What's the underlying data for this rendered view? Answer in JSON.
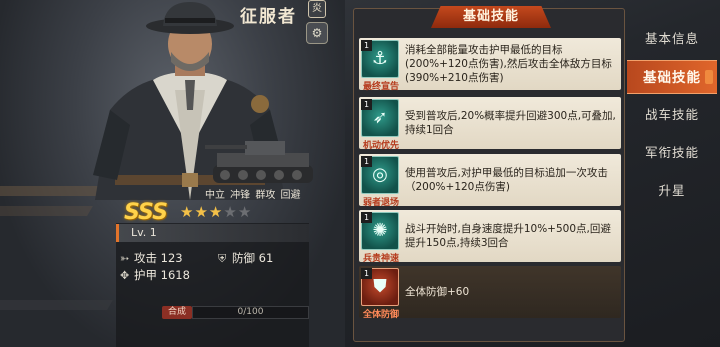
{
  "hero": {
    "title": "征服者",
    "rank_badge": "炎",
    "tags": "中立 冲锋 群攻 回避",
    "grade": "SSS",
    "stars_filled": 3,
    "stars_total": 5,
    "level": "Lv. 1",
    "attack": "攻击 123",
    "defense": "防御 61",
    "armor": "护甲 1618",
    "merge_label": "合成",
    "progress_text": "0/100",
    "progress_value": 0.0
  },
  "skills": {
    "header": "基础技能",
    "items": [
      {
        "level": "1",
        "name": "最终宣告",
        "icon": "anchor-icon",
        "desc": "消耗全部能量攻击护甲最低的目标(200%+120点伤害),然后攻击全体敌方目标(390%+210点伤害)"
      },
      {
        "level": "1",
        "name": "机动优先",
        "icon": "boot-icon",
        "desc": "受到普攻后,20%概率提升回避300点,可叠加,持续1回合"
      },
      {
        "level": "1",
        "name": "弱者退场",
        "icon": "target-icon",
        "desc": "使用普攻后,对护甲最低的目标追加一次攻击（200%+120点伤害)"
      },
      {
        "level": "1",
        "name": "兵贵神速",
        "icon": "swirl-icon",
        "desc": "战斗开始时,自身速度提升10%+500点,回避提升150点,持续3回合"
      },
      {
        "level": "1",
        "name": "全体防御",
        "icon": "shield-icon",
        "desc": "全体防御+60"
      }
    ]
  },
  "tabs": [
    {
      "label": "基本信息",
      "active": false
    },
    {
      "label": "基础技能",
      "active": true
    },
    {
      "label": "战车技能",
      "active": false
    },
    {
      "label": "军衔技能",
      "active": false
    },
    {
      "label": "升星",
      "active": false
    }
  ],
  "colors": {
    "accent": "#e0662b",
    "grade_gold": "#ffd24a",
    "skill_name_red": "#b53a1c"
  }
}
